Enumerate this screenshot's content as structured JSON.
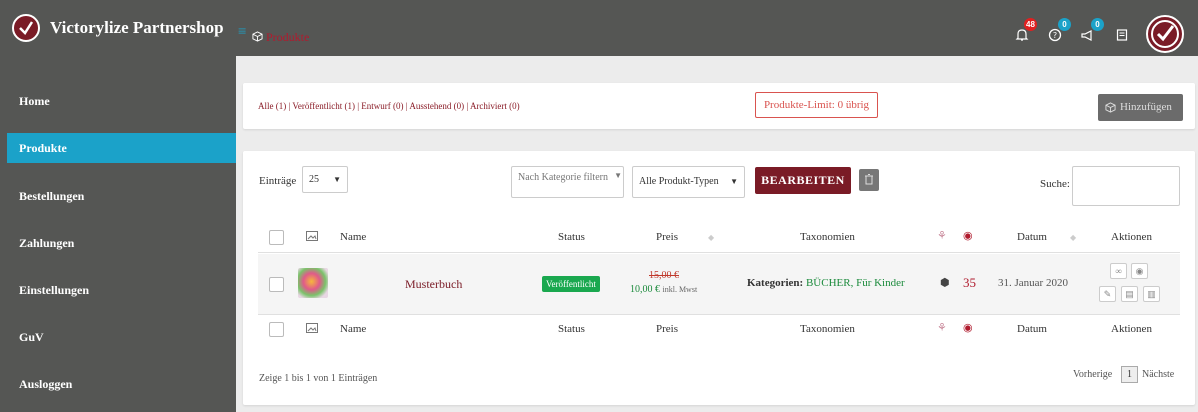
{
  "app": {
    "title": "Victorylize Partnershop"
  },
  "breadcrumb": {
    "current": "Produkte"
  },
  "notifications": {
    "bell_count": "48",
    "help_count": "0",
    "announce_count": "0"
  },
  "sidebar": {
    "items": [
      {
        "label": "Home",
        "active": false
      },
      {
        "label": "Produkte",
        "active": true
      },
      {
        "label": "Bestellungen",
        "active": false
      },
      {
        "label": "Zahlungen",
        "active": false
      },
      {
        "label": "Einstellungen",
        "active": false
      },
      {
        "label": "GuV",
        "active": false
      },
      {
        "label": "Ausloggen",
        "active": false
      }
    ]
  },
  "status_filters": {
    "all": "Alle (1)",
    "published": "Veröffentlicht (1)",
    "draft": "Entwurf (0)",
    "pending": "Ausstehend (0)",
    "archived": "Archiviert (0)",
    "sep": "|"
  },
  "limit_label": "Produkte-Limit: 0 übrig",
  "add_button": "Hinzufügen",
  "toolbar": {
    "entries_label": "Einträge",
    "entries_value": "25",
    "category_filter": "Nach Kategorie filtern",
    "type_filter": "Alle Produkt-Typen",
    "edit_button": "BEARBEITEN",
    "search_label": "Suche:"
  },
  "table": {
    "headers": {
      "name": "Name",
      "status": "Status",
      "price": "Preis",
      "taxonomies": "Taxonomien",
      "date": "Datum",
      "actions": "Aktionen"
    },
    "rows": [
      {
        "name": "Musterbuch",
        "status": "Veröffentlicht",
        "price_old": "15,00 €",
        "price_new": "10,00 €",
        "price_note": "inkl. Mwst",
        "tax_label": "Kategorien:",
        "tax_value": "BÜCHER, Für Kinder",
        "views": "35",
        "date": "31. Januar 2020"
      }
    ]
  },
  "footer": {
    "info": "Zeige 1 bis 1 von 1 Einträgen",
    "prev": "Vorherige",
    "page": "1",
    "next": "Nächste"
  },
  "colors": {
    "accent": "#1ba2c9",
    "brand": "#7a1b26",
    "sidebar": "#555654",
    "published": "#1aa84f"
  }
}
